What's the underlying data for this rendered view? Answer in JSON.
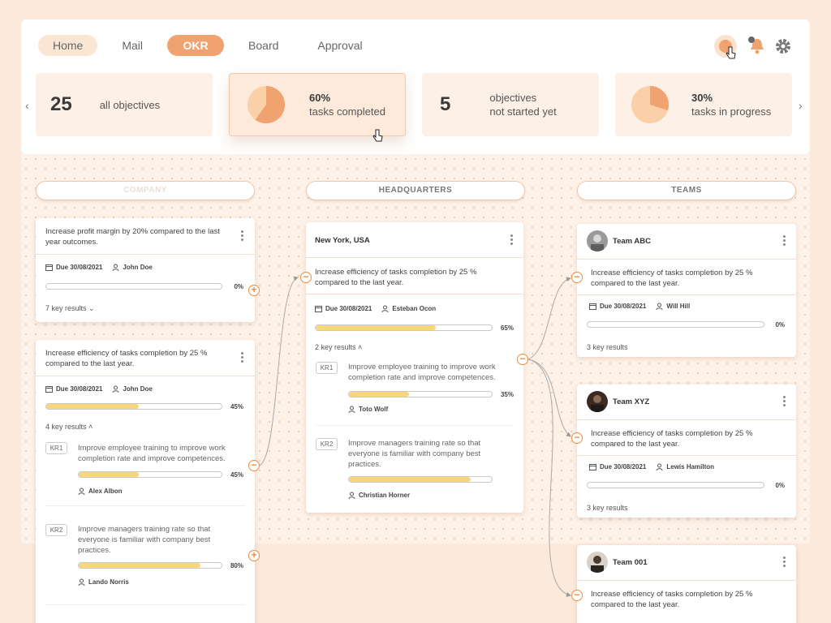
{
  "nav": {
    "items": [
      "Home",
      "Mail",
      "OKR",
      "Board",
      "Approval"
    ],
    "active": "OKR"
  },
  "colors": {
    "accent": "#f0a36e",
    "bar_fill": "#f8d77c",
    "connector": "#f08a3c"
  },
  "stats": [
    {
      "value": "25",
      "label": "all objectives",
      "pie": null
    },
    {
      "value": "60%",
      "label": "tasks completed",
      "pie": 0.6
    },
    {
      "value": "5",
      "label1": "objectives",
      "label2": "not started yet",
      "pie": null
    },
    {
      "value": "30%",
      "label": "tasks in progress",
      "pie": 0.3
    }
  ],
  "columns": {
    "company": "COMPANY",
    "hq": "HEADQUARTERS",
    "teams": "TEAMS"
  },
  "company_cards": [
    {
      "title": "Increase profit margin by 20% compared to the last year outcomes.",
      "due": "Due 30/08/2021",
      "owner": "John Doe",
      "progress": 0,
      "pct": "0%",
      "key_results": "7 key results"
    },
    {
      "title": "Increase efficiency of tasks completion by 25 % compared to the last year.",
      "due": "Due 30/08/2021",
      "owner": "John Doe",
      "progress": 45,
      "pct": "45%",
      "key_results": "4 key results",
      "krs": [
        {
          "badge": "KR1",
          "text": "Improve employee training to improve work completion rate and improve competences.",
          "progress": 45,
          "pct": "45%",
          "owner": "Alex Albon"
        },
        {
          "badge": "KR2",
          "text": "Improve managers training rate so that everyone is familiar with company best practices.",
          "progress": 80,
          "pct": "80%",
          "owner": "Lando Norris"
        }
      ]
    }
  ],
  "hq_card": {
    "location": "New York, USA",
    "title": "Increase efficiency of tasks completion by 25 % compared to the last year.",
    "due": "Due 30/08/2021",
    "owner": "Esteban Ocon",
    "progress": 65,
    "pct": "65%",
    "key_results": "2 key results",
    "krs": [
      {
        "badge": "KR1",
        "text": "Improve employee training to improve work completion rate and improve competences.",
        "progress": 35,
        "pct": "35%",
        "owner": "Toto Wolf"
      },
      {
        "badge": "KR2",
        "text": "Improve managers training rate so that everyone is familiar with company best practices.",
        "progress": 85,
        "pct": "",
        "owner": "Christian Horner"
      }
    ]
  },
  "team_cards": [
    {
      "team": "Team ABC",
      "title": "Increase efficiency of tasks completion by 25 % compared to the last year.",
      "due": "Due 30/08/2021",
      "owner": "Will Hill",
      "progress": 0,
      "pct": "0%",
      "key_results": "3 key results"
    },
    {
      "team": "Team XYZ",
      "title": "Increase efficiency of tasks completion by 25 % compared to the last year.",
      "due": "Due 30/08/2021",
      "owner": "Lewis Hamilton",
      "progress": 0,
      "pct": "0%",
      "key_results": "3 key results"
    },
    {
      "team": "Team 001",
      "title": "Increase efficiency of tasks completion by 25 % compared to the last year."
    }
  ]
}
